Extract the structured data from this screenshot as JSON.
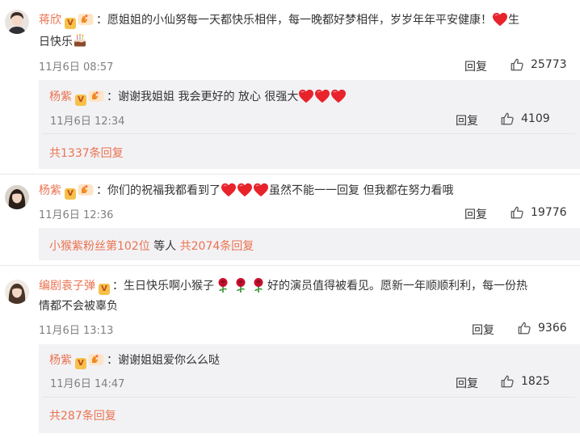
{
  "comments": [
    {
      "user": "蒋欣",
      "text_part1": "愿姐姐的小仙努每一天都快乐相伴，每一晚都好梦相伴，岁岁年年平安健康！",
      "text_part2": "生",
      "text_line2": "日快乐",
      "time": "11月6日 08:57",
      "reply_label": "回复",
      "likes": "25773",
      "sub_reply": {
        "user": "杨紫",
        "text": "谢谢我姐姐 我会更好的 放心 很强大",
        "time": "11月6日 12:34",
        "reply_label": "回复",
        "likes": "4109"
      },
      "more_replies": "共1337条回复"
    },
    {
      "user": "杨紫",
      "text_part1": "你们的祝福我都看到了",
      "text_part2": "虽然不能一一回复 但我都在努力看哦",
      "time": "11月6日 12:36",
      "reply_label": "回复",
      "likes": "19776",
      "more_user": "小猴紫粉丝第102位",
      "more_mid": " 等人 ",
      "more_replies": "共2074条回复"
    },
    {
      "user": "编剧袁子弹",
      "text_part1": "生日快乐啊小猴子",
      "text_part2": "好的演员值得被看见。愿新一年顺顺利利，每一份热",
      "text_line2": "情都不会被辜负",
      "time": "11月6日 13:13",
      "reply_label": "回复",
      "likes": "9366",
      "sub_reply": {
        "user": "杨紫",
        "text": "谢谢姐姐爱你么么哒",
        "time": "11月6日 14:47",
        "reply_label": "回复",
        "likes": "1825"
      },
      "more_replies": "共287条回复"
    }
  ],
  "icons": {
    "verified": "verified-v-badge-icon",
    "member": "member-hand-badge-icon",
    "like": "thumbs-up-icon",
    "heart": "red-heart-emoji",
    "rose": "rose-emoji",
    "cake": "birthday-cake-emoji"
  },
  "colors": {
    "username": "#eb7350",
    "meta": "#808080",
    "text": "#333333",
    "sub_bg": "#f2f2f5",
    "heart": "#e8232b"
  }
}
